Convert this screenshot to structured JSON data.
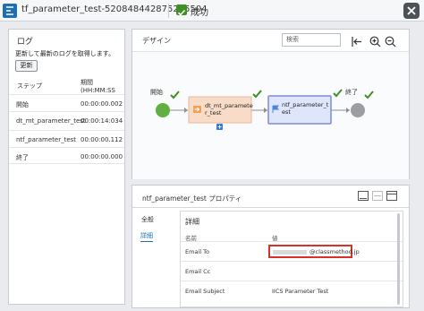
{
  "window": {
    "title": "tf_parameter_test-520848442875285504",
    "status": "成功",
    "icon": "taskflow-icon",
    "status_icon": "check-icon",
    "close_icon": "close-icon"
  },
  "log": {
    "title": "ログ",
    "description": "更新して最新のログを取得します。",
    "update_button": "更新",
    "col_step": "ステップ",
    "col_period": "期間",
    "col_period_unit": "(HH:MM:SS",
    "rows": [
      {
        "step": "開始",
        "time": "00:00:00.002"
      },
      {
        "step": "dt_mt_parameter_test",
        "time": "00:00:14:034"
      },
      {
        "step": "ntf_parameter_test",
        "time": "00:00:00.112"
      },
      {
        "step": "終了",
        "time": "00:00:00.000"
      }
    ]
  },
  "design": {
    "title": "デザイン",
    "search_placeholder": "検索",
    "tools": [
      "fit-to-screen-icon",
      "zoom-in-icon",
      "zoom-out-icon"
    ],
    "nodes": {
      "start": "開始",
      "task_line1": "dt_mt_paramete",
      "task_line2": "r_test",
      "notify_line1": "ntf_parameter_t",
      "notify_line2": "est",
      "end": "終了"
    },
    "colors": {
      "success": "#3f8f27",
      "task_fill": "#f9dcc7",
      "notify_fill": "#dfe5fa",
      "notify_border": "#7c8bd9"
    }
  },
  "properties": {
    "title": "ntf_parameter_test プロパティ",
    "tabs": {
      "general": "全般",
      "detail": "詳細"
    },
    "detail_title": "詳細",
    "col_name": "名前",
    "col_value": "値",
    "rows": [
      {
        "name": "Email To",
        "value": "@classmethod.jp"
      },
      {
        "name": "Email Cc",
        "value": ""
      },
      {
        "name": "Email Subject",
        "value": "IICS Parameter Test"
      }
    ],
    "highlight_color": "#d6322b"
  }
}
